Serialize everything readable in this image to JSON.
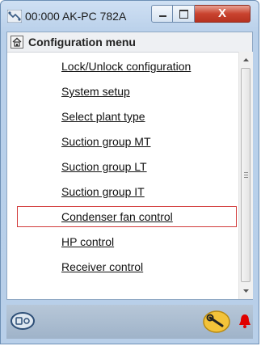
{
  "window": {
    "title": "00:000 AK-PC 782A",
    "close_label": "X"
  },
  "header": {
    "title": "Configuration menu"
  },
  "menu": {
    "items": [
      {
        "label": "Lock/Unlock configuration"
      },
      {
        "label": "System setup"
      },
      {
        "label": "Select plant type"
      },
      {
        "label": "Suction group MT"
      },
      {
        "label": "Suction group LT"
      },
      {
        "label": "Suction group IT"
      },
      {
        "label": "Condenser fan control",
        "selected": true
      },
      {
        "label": "HP control"
      },
      {
        "label": "Receiver control"
      }
    ]
  },
  "icons": {
    "app": "network-icon",
    "home": "home-icon",
    "status_left": "controller-icon",
    "status_tool": "wrench-icon",
    "status_alarm": "alarm-bell-icon"
  },
  "colors": {
    "selection_border": "#d23b3b",
    "close_button": "#c9432f",
    "alarm": "#e00000"
  }
}
